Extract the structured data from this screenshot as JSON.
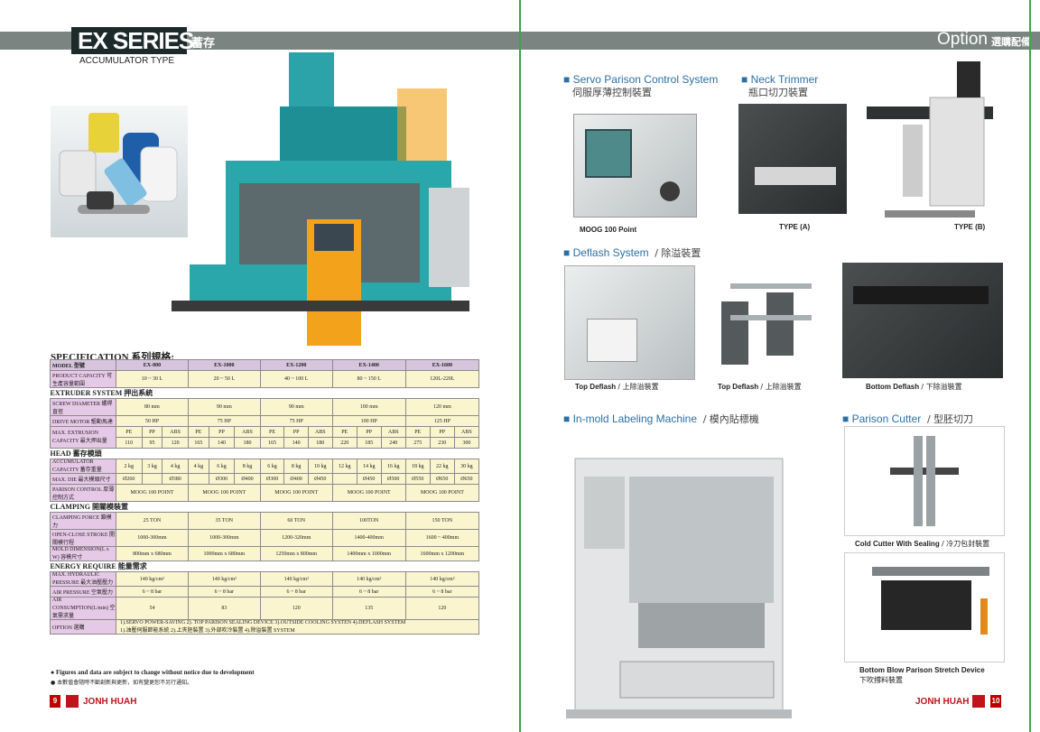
{
  "left": {
    "title": "EX SERIES",
    "title_cn": "蓄存",
    "subtitle": "ACCUMULATOR TYPE",
    "spec_heading": "SPECIFICATION  系列規格:",
    "header_row": [
      "MODEL 型號",
      "EX-800",
      "EX-1000",
      "EX-1200",
      "EX-1400",
      "EX-1600"
    ],
    "product_capacity": {
      "label": "PRODUCT CAPACITY 可生產容量範圍",
      "values": [
        "10 ~ 30 L",
        "20 ~ 50 L",
        "40 ~ 100 L",
        "80 ~ 150 L",
        "120L-220L"
      ]
    },
    "extruder_title": "EXTRUDER SYSTEM  押出系統",
    "screw": {
      "label": "SCREW DIAMETER 螺桿直徑",
      "values": [
        "80 mm",
        "90 mm",
        "90 mm",
        "100 mm",
        "120 mm"
      ]
    },
    "drive": {
      "label": "DRIVE MOTOR 驅動馬達",
      "values": [
        "50 HP",
        "75 HP",
        "75 HP",
        "100 HP",
        "125 HP"
      ]
    },
    "extrusion": {
      "label": "MAX. EXTRUSION CAPACITY 最大押出量",
      "sub": [
        "PE",
        "PP",
        "ABS",
        "PE",
        "PP",
        "ABS",
        "PE",
        "PP",
        "ABS",
        "PE",
        "PP",
        "ABS",
        "PE",
        "PP",
        "ABS"
      ],
      "values": [
        "110",
        "95",
        "120",
        "165",
        "140",
        "180",
        "165",
        "140",
        "180",
        "220",
        "185",
        "240",
        "275",
        "230",
        "300"
      ]
    },
    "head_title": "HEAD  蓄存模頭",
    "accum": {
      "label": "ACCUMULATOR CAPACITY 蓄存重量",
      "values": [
        "2 kg",
        "3 kg",
        "4 kg",
        "4 kg",
        "6 kg",
        "8 kg",
        "6 kg",
        "8 kg",
        "10 kg",
        "12 kg",
        "14 kg",
        "16 kg",
        "18 kg",
        "22 kg",
        "30 kg"
      ]
    },
    "die": {
      "label": "MAX. DIE 最大模頭尺寸",
      "values": [
        "Ø260",
        "",
        "Ø380",
        "",
        "Ø300",
        "Ø400",
        "Ø300",
        "Ø400",
        "Ø450",
        "",
        "Ø450",
        "Ø500",
        "Ø550",
        "Ø650",
        "Ø650"
      ]
    },
    "parison": {
      "label": "PARISON CONTROL 厚薄控制方式",
      "values": [
        "MOOG 100 POINT",
        "MOOG 100 POINT",
        "MOOG 100 POINT",
        "MOOG 100 POINT",
        "MOOG 100 POINT"
      ]
    },
    "clamping_title": "CLAMPING  開關模裝置",
    "clamp_force": {
      "label": "CLAMPING FORCE 鎖模力",
      "values": [
        "25 TON",
        "35 TON",
        "60 TON",
        "100TON",
        "150 TON"
      ]
    },
    "stroke": {
      "label": "OPEN-CLOSE STROKE 開關模行程",
      "values": [
        "1000-300mm",
        "1000-300mm",
        "1200-320mm",
        "1400-400mm",
        "1600 ~ 400mm"
      ]
    },
    "mold": {
      "label": "MOLD DIMENSION(L x W) 容模尺寸",
      "values": [
        "800mm x 680mm",
        "1000mm x 680mm",
        "1250mm x 800mm",
        "1400mm x 1000mm",
        "1600mm x 1200mm"
      ]
    },
    "energy_title": "ENERGY REQUIRE  能量需求",
    "hydraulic": {
      "label": "MAX. HYDRAULIC PRESSURE 最大油壓壓力",
      "values": [
        "140 kg/cm²",
        "140 kg/cm²",
        "140 kg/cm²",
        "140 kg/cm²",
        "140 kg/cm²"
      ]
    },
    "air": {
      "label": "AIR PRESSURE 空氣壓力",
      "values": [
        "6 ~ 8 bar",
        "6 ~ 8 bar",
        "6 ~ 8 bar",
        "6 ~ 8 bar",
        "6 ~ 8 bar"
      ]
    },
    "air_cons": {
      "label": "AIR CONSUMPTION(L/min) 空氣需求量",
      "values": [
        "54",
        "83",
        "120",
        "135",
        "120"
      ]
    },
    "option": {
      "label": "OPTION 選購",
      "line1": "1).SERVO POWER-SAVING 2). TOP PARISON SEALING DEVICE 3).OUTSIDE COOLING SYSTEN 4).DEFLASH SYSTEM",
      "line2": "1).油壓伺服節能系統 2).上夾胚裝置 3).外部吹冷裝置 4).除溢裝置 SYSTEM"
    },
    "note1": "● Figures and data are subject to change without notice due to development",
    "note2": "● 本數值會隨時不斷創新與更新，如有變更恕不另行通知。",
    "page_number": "9",
    "brand": "JONH HUAH"
  },
  "right": {
    "title": "Option",
    "title_cn": "選購配備",
    "servo": {
      "title": "Servo Parison Control System",
      "cn": "伺服厚薄控制裝置",
      "caption": "MOOG 100 Point"
    },
    "neck": {
      "title": "Neck Trimmer",
      "cn": "瓶口切刀裝置",
      "caption_a": "TYPE (A)",
      "caption_b": "TYPE (B)"
    },
    "deflash": {
      "title": "Deflash System",
      "sep": "/",
      "cn": "除溢裝置",
      "cap1": "Top Deflash",
      "cap1_cn": "/ 上除溢裝置",
      "cap2": "Top Deflash",
      "cap2_cn": "/ 上除溢裝置",
      "cap3": "Bottom Deflash",
      "cap3_cn": "/ 下除溢裝置"
    },
    "iml": {
      "title": "In-mold Labeling Machine",
      "sep": "/",
      "cn": "模內貼標機"
    },
    "parison_cutter": {
      "title": "Parison Cutter",
      "sep": "/",
      "cn": "型胚切刀",
      "cap1": "Cold Cutter With Sealing",
      "cap1_cn": "/ 冷刀包封裝置",
      "cap2": "Bottom Blow Parison Stretch Device",
      "cap2_cn": "下吹撐料裝置"
    },
    "page_number": "10",
    "brand": "JONH HUAH"
  },
  "colors": {
    "accent_green": "#3aa64a",
    "header_gray": "#7b8480",
    "brand_red": "#c0131b",
    "link_blue": "#2d6fa3"
  }
}
